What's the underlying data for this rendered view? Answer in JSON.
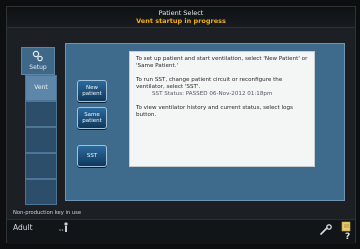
{
  "header": {
    "title": "Patient Select",
    "subtitle": "Vent startup in progress"
  },
  "sidebar": {
    "setup_label": "Setup",
    "vent_label": "Vent"
  },
  "patient_buttons": {
    "new_patient": "New\npatient",
    "same_patient": "Same\npatient",
    "sst": "SST"
  },
  "info": {
    "para1": "To set up patient and start ventilation, select 'New Patient' or 'Same Patient.'",
    "para2": "To run SST, change patient circuit or reconfigure the ventilator, select 'SST'.",
    "sst_status": "SST Status: PASSED 06-Nov-2012 01:18pm",
    "para3": "To view ventilator history and current status, select logs button."
  },
  "status": {
    "nonproduction_note": "Non-production key in use",
    "patient_type": "Adult"
  },
  "icons": {
    "help": "?"
  },
  "colors": {
    "accent": "#f2b019",
    "panel": "#3e6a8c",
    "button": "#1f5283"
  }
}
